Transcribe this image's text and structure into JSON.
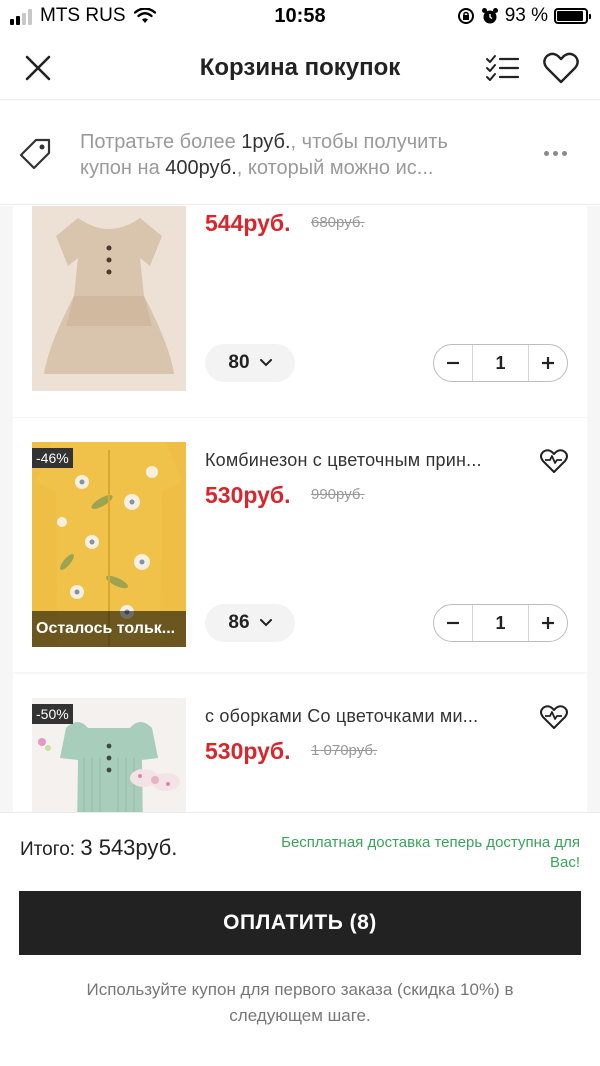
{
  "status_bar": {
    "carrier": "MTS RUS",
    "time": "10:58",
    "battery": "93 %",
    "battery_level": 0.93
  },
  "header": {
    "title": "Корзина покупок"
  },
  "promo": {
    "line1_prefix": "Потратьте более ",
    "line1_amount": "1руб.",
    "line1_suffix": ", чтобы получить",
    "line2_prefix": "купон на ",
    "line2_amount": "400руб.",
    "line2_suffix": ", который можно ис..."
  },
  "cart_items": [
    {
      "price": "544руб.",
      "old_price": "680руб.",
      "size": "80",
      "quantity": "1",
      "image_color": "#e5d2c0"
    },
    {
      "badge": "-46%",
      "title": "Комбинезон с цветочным прин...",
      "price": "530руб.",
      "old_price": "990руб.",
      "size": "86",
      "quantity": "1",
      "thumb_note": "Осталось тольк...",
      "image_color": "#efbf45"
    },
    {
      "badge": "-50%",
      "title": "с оборками Со цветочками ми...",
      "price": "530руб.",
      "old_price": "1 070руб.",
      "image_color": "#a9cdbb"
    }
  ],
  "footer": {
    "total_label": "Итого: ",
    "total_value": "3 543руб.",
    "free_shipping": "Бесплатная доставка теперь доступна для Вас!",
    "pay_button": "ОПЛАТИТЬ (8)",
    "coupon_note": "Используйте купон для первого заказа (скидка 10%) в следующем шаге."
  }
}
